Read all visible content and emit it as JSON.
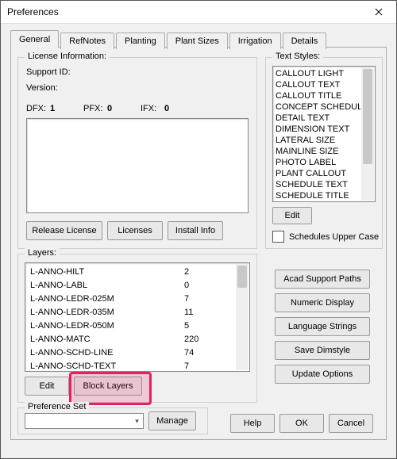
{
  "window": {
    "title": "Preferences"
  },
  "tabs": [
    "General",
    "RefNotes",
    "Planting",
    "Plant Sizes",
    "Irrigation",
    "Details"
  ],
  "license": {
    "legend": "License Information:",
    "support_label": "Support ID:",
    "version_label": "Version:",
    "dfx_label": "DFX:",
    "dfx_value": "1",
    "pfx_label": "PFX:",
    "pfx_value": "0",
    "ifx_label": "IFX:",
    "ifx_value": "0",
    "btn_release": "Release License",
    "btn_licenses": "Licenses",
    "btn_install": "Install Info"
  },
  "styles": {
    "legend": "Text Styles:",
    "items": [
      "CALLOUT LIGHT",
      "CALLOUT TEXT",
      "CALLOUT TITLE",
      "CONCEPT SCHEDULE TE",
      "DETAIL TEXT",
      "DIMENSION TEXT",
      "LATERAL SIZE",
      "MAINLINE SIZE",
      "PHOTO LABEL",
      "PLANT CALLOUT",
      "SCHEDULE TEXT",
      "SCHEDULE TITLE"
    ],
    "btn_edit": "Edit",
    "chk_upper": "Schedules Upper Case"
  },
  "layers": {
    "legend": "Layers:",
    "rows": [
      {
        "name": "L-ANNO-HILT",
        "val": "2"
      },
      {
        "name": "L-ANNO-LABL",
        "val": "0"
      },
      {
        "name": "L-ANNO-LEDR-025M",
        "val": "7"
      },
      {
        "name": "L-ANNO-LEDR-035M",
        "val": "11"
      },
      {
        "name": "L-ANNO-LEDR-050M",
        "val": "5"
      },
      {
        "name": "L-ANNO-MATC",
        "val": "220"
      },
      {
        "name": "L-ANNO-SCHD-LINE",
        "val": "74"
      },
      {
        "name": "L-ANNO-SCHD-TEXT",
        "val": "7"
      }
    ],
    "btn_edit": "Edit",
    "btn_block": "Block Layers"
  },
  "right_buttons": [
    "Acad Support Paths",
    "Numeric Display",
    "Language Strings",
    "Save Dimstyle",
    "Update Options"
  ],
  "pref_set": {
    "legend": "Preference Set",
    "btn_manage": "Manage"
  },
  "footer": {
    "help": "Help",
    "ok": "OK",
    "cancel": "Cancel"
  }
}
